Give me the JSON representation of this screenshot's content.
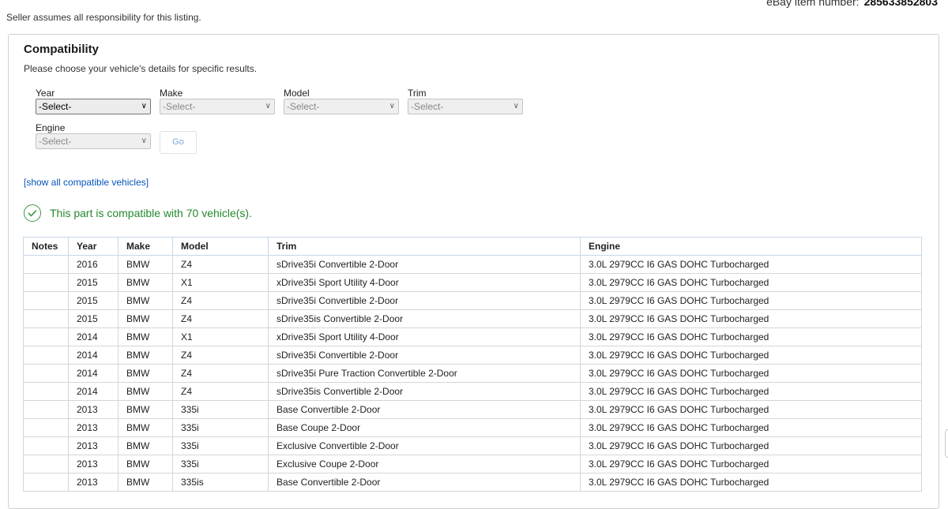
{
  "header": {
    "item_number_label": "eBay item number:",
    "item_number_value": "285633852803",
    "seller_note": "Seller assumes all responsibility for this listing."
  },
  "compatibility": {
    "title": "Compatibility",
    "subtitle": "Please choose your vehicle's details for specific results.",
    "fields": {
      "year": {
        "label": "Year",
        "value": "-Select-"
      },
      "make": {
        "label": "Make",
        "value": "-Select-"
      },
      "model": {
        "label": "Model",
        "value": "-Select-"
      },
      "trim": {
        "label": "Trim",
        "value": "-Select-"
      },
      "engine": {
        "label": "Engine",
        "value": "-Select-"
      }
    },
    "go_label": "Go",
    "show_all_link": "[show all compatible vehicles]",
    "status_text": "This part is compatible with 70 vehicle(s).",
    "colors": {
      "success": "#238a2c",
      "link": "#0654ba"
    }
  },
  "table": {
    "headers": [
      "Notes",
      "Year",
      "Make",
      "Model",
      "Trim",
      "Engine"
    ],
    "rows": [
      [
        "",
        "2016",
        "BMW",
        "Z4",
        "sDrive35i Convertible 2-Door",
        "3.0L 2979CC I6 GAS DOHC Turbocharged"
      ],
      [
        "",
        "2015",
        "BMW",
        "X1",
        "xDrive35i Sport Utility 4-Door",
        "3.0L 2979CC I6 GAS DOHC Turbocharged"
      ],
      [
        "",
        "2015",
        "BMW",
        "Z4",
        "sDrive35i Convertible 2-Door",
        "3.0L 2979CC I6 GAS DOHC Turbocharged"
      ],
      [
        "",
        "2015",
        "BMW",
        "Z4",
        "sDrive35is Convertible 2-Door",
        "3.0L 2979CC I6 GAS DOHC Turbocharged"
      ],
      [
        "",
        "2014",
        "BMW",
        "X1",
        "xDrive35i Sport Utility 4-Door",
        "3.0L 2979CC I6 GAS DOHC Turbocharged"
      ],
      [
        "",
        "2014",
        "BMW",
        "Z4",
        "sDrive35i Convertible 2-Door",
        "3.0L 2979CC I6 GAS DOHC Turbocharged"
      ],
      [
        "",
        "2014",
        "BMW",
        "Z4",
        "sDrive35i Pure Traction Convertible 2-Door",
        "3.0L 2979CC I6 GAS DOHC Turbocharged"
      ],
      [
        "",
        "2014",
        "BMW",
        "Z4",
        "sDrive35is Convertible 2-Door",
        "3.0L 2979CC I6 GAS DOHC Turbocharged"
      ],
      [
        "",
        "2013",
        "BMW",
        "335i",
        "Base Convertible 2-Door",
        "3.0L 2979CC I6 GAS DOHC Turbocharged"
      ],
      [
        "",
        "2013",
        "BMW",
        "335i",
        "Base Coupe 2-Door",
        "3.0L 2979CC I6 GAS DOHC Turbocharged"
      ],
      [
        "",
        "2013",
        "BMW",
        "335i",
        "Exclusive Convertible 2-Door",
        "3.0L 2979CC I6 GAS DOHC Turbocharged"
      ],
      [
        "",
        "2013",
        "BMW",
        "335i",
        "Exclusive Coupe 2-Door",
        "3.0L 2979CC I6 GAS DOHC Turbocharged"
      ],
      [
        "",
        "2013",
        "BMW",
        "335is",
        "Base Convertible 2-Door",
        "3.0L 2979CC I6 GAS DOHC Turbocharged"
      ]
    ]
  },
  "icons": {
    "status": "check-circle-icon",
    "select": "chevron-down-icon"
  }
}
